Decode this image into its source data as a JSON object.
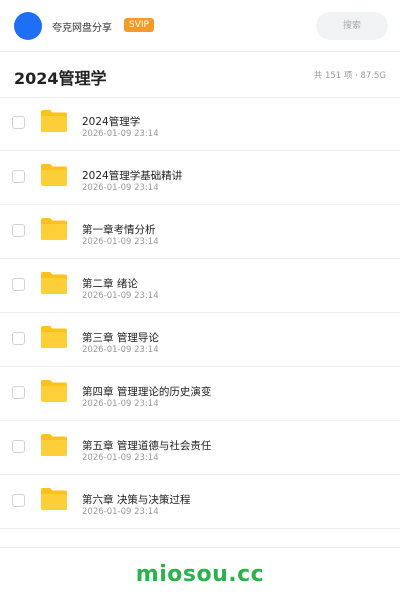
{
  "header": {
    "username": "夸克网盘分享",
    "badge": "SVIP",
    "search_label": "搜索"
  },
  "title_row": {
    "title": "2024管理学",
    "summary": "共 151 项 · 87.5G"
  },
  "files": [
    {
      "name": "2024管理学",
      "date": "2026-01-09 23:14"
    },
    {
      "name": "2024管理学基础精讲",
      "date": "2026-01-09 23:14"
    },
    {
      "name": "第一章考情分析",
      "date": "2026-01-09 23:14"
    },
    {
      "name": "第二章 绪论",
      "date": "2026-01-09 23:14"
    },
    {
      "name": "第三章 管理导论",
      "date": "2026-01-09 23:14"
    },
    {
      "name": "第四章 管理理论的历史演变",
      "date": "2026-01-09 23:14"
    },
    {
      "name": "第五章 管理道德与社会责任",
      "date": "2026-01-09 23:14"
    },
    {
      "name": "第六章  决策与决策过程",
      "date": "2026-01-09 23:14"
    }
  ],
  "watermark": "miosou.cc",
  "colors": {
    "avatar": "#1e6ff5",
    "badge": "#f39a2b",
    "folder": "#ffc21a",
    "watermark": "#2bb24c"
  },
  "icons": {
    "folder": "folder-icon",
    "checkbox": "checkbox-icon"
  }
}
